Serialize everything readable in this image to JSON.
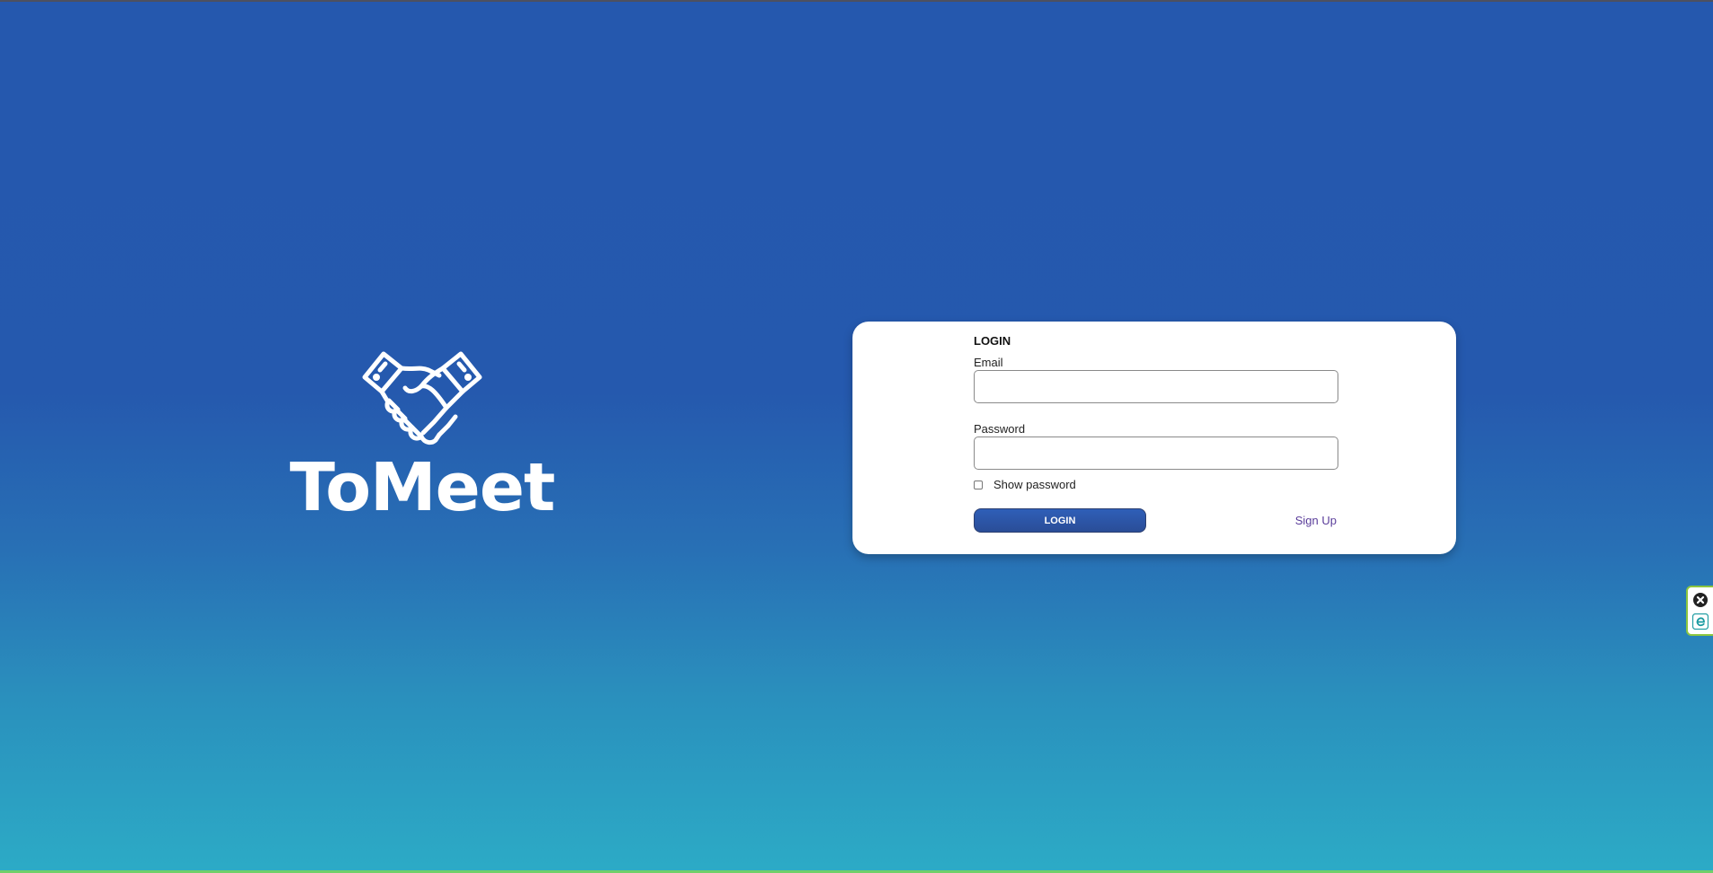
{
  "brand": {
    "name": "ToMeet",
    "logo_icon": "handshake-icon"
  },
  "login_form": {
    "title": "LOGIN",
    "email_label": "Email",
    "email_value": "",
    "password_label": "Password",
    "password_value": "",
    "show_password_label": "Show password",
    "show_password_checked": false,
    "login_button_label": "LOGIN",
    "signup_link_label": "Sign Up"
  },
  "extension_widget": {
    "close_icon": "close-circle-icon",
    "logo_icon": "eset-e-icon"
  },
  "colors": {
    "background_top": "#2558ae",
    "background_bottom": "#2cabc6",
    "card": "#ffffff",
    "button": "#2a5aae",
    "link": "#5a3d9a",
    "extension_border": "#8cc63f"
  }
}
